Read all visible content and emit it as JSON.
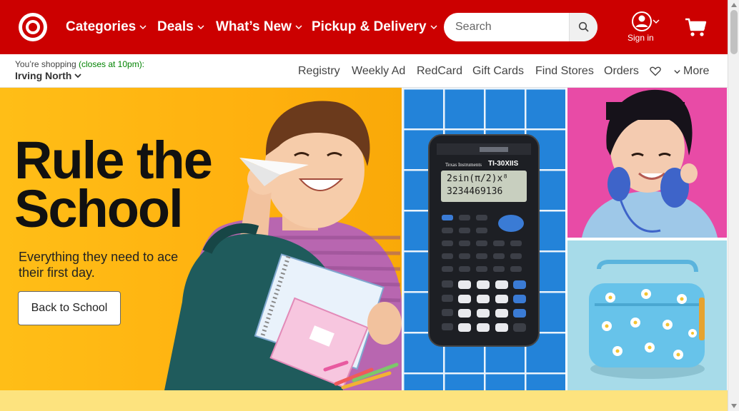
{
  "header": {
    "brand_color": "#cc0000",
    "nav": [
      {
        "label": "Categories"
      },
      {
        "label": "Deals"
      },
      {
        "label": "What’s New"
      },
      {
        "label": "Pickup & Delivery"
      }
    ],
    "search_placeholder": "Search",
    "signin_label": "Sign in"
  },
  "store": {
    "shopping_prefix": "You’re shopping",
    "hours": "(closes at 10pm):",
    "name": "Irving North"
  },
  "subnav": {
    "links": [
      "Registry",
      "Weekly Ad",
      "RedCard",
      "Gift Cards",
      "Find Stores",
      "Orders"
    ],
    "more_label": "More"
  },
  "hero": {
    "headline": "Rule the School",
    "subtext": "Everything they need to ace their first day.",
    "cta_label": "Back to School"
  },
  "promo_tiles": [
    {
      "image": "graphing-calculator"
    },
    {
      "image": "girl-with-headphones"
    },
    {
      "image": "daisy-lunch-bag"
    }
  ],
  "calculator": {
    "brand": "Texas Instruments",
    "model": "TI-30XIIS",
    "display_line1": "2sin(π/2)x⁸",
    "display_line2": "3234469136"
  }
}
